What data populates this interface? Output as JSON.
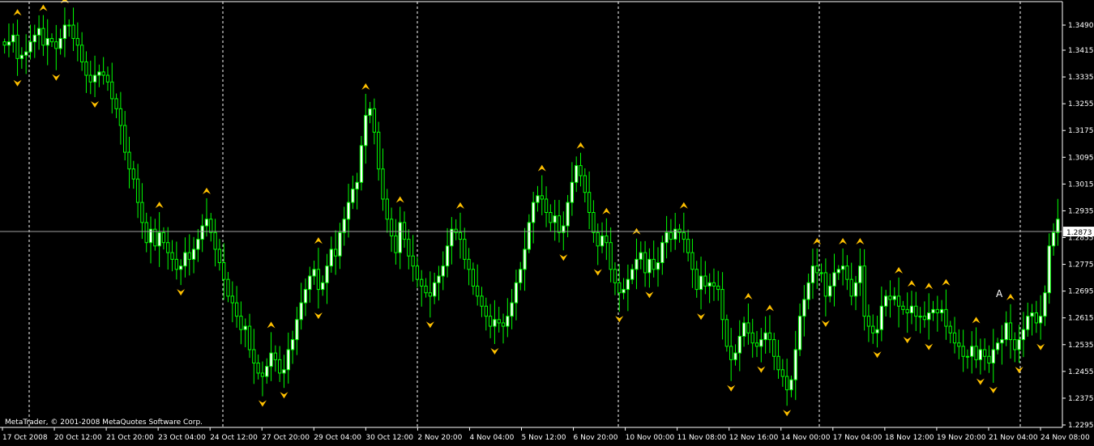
{
  "colors": {
    "background": "#000000",
    "axis": "#ffffff",
    "candle_up": "#ffffff",
    "candle_down": "#00ff00",
    "wick": "#00ff00",
    "fractal": "#ffc000",
    "bid_line": "#a0a0a0",
    "bid_label_bg": "#ffffff",
    "bid_label_text": "#000000"
  },
  "chart_data": {
    "type": "candlestick",
    "title": "",
    "watermark": "MetaTrader, © 2001-2008 MetaQuotes Software Corp.",
    "annotation": "A",
    "ylim": [
      1.2275,
      1.3535
    ],
    "y_ticks": [
      "1.3490",
      "1.3415",
      "1.3335",
      "1.3255",
      "1.3175",
      "1.3095",
      "1.3015",
      "1.2935",
      "1.2855",
      "1.2775",
      "1.2695",
      "1.2615",
      "1.2535",
      "1.2455",
      "1.2375",
      "1.2295"
    ],
    "current_price": "1.2873",
    "x_labels": [
      "17 Oct 2008",
      "20 Oct 12:00",
      "21 Oct 20:00",
      "23 Oct 04:00",
      "24 Oct 12:00",
      "27 Oct 20:00",
      "29 Oct 04:00",
      "30 Oct 12:00",
      "2 Nov 20:00",
      "4 Nov 04:00",
      "5 Nov 12:00",
      "6 Nov 20:00",
      "10 Nov 00:00",
      "11 Nov 08:00",
      "12 Nov 16:00",
      "14 Nov 00:00",
      "17 Nov 04:00",
      "18 Nov 12:00",
      "19 Nov 20:00",
      "21 Nov 04:00",
      "24 Nov 08:00"
    ],
    "grid": "vertical-dashed",
    "close_path": [
      1.343,
      1.344,
      1.346,
      1.339,
      1.34,
      1.341,
      1.344,
      1.346,
      1.348,
      1.343,
      1.345,
      1.344,
      1.342,
      1.345,
      1.349,
      1.349,
      1.345,
      1.343,
      1.338,
      1.334,
      1.332,
      1.334,
      1.335,
      1.334,
      1.332,
      1.327,
      1.324,
      1.319,
      1.311,
      1.306,
      1.303,
      1.296,
      1.29,
      1.284,
      1.288,
      1.283,
      1.287,
      1.284,
      1.281,
      1.279,
      1.276,
      1.277,
      1.281,
      1.279,
      1.282,
      1.285,
      1.289,
      1.291,
      1.287,
      1.282,
      1.278,
      1.273,
      1.268,
      1.266,
      1.262,
      1.258,
      1.259,
      1.252,
      1.248,
      1.245,
      1.244,
      1.247,
      1.251,
      1.249,
      1.245,
      1.246,
      1.252,
      1.255,
      1.261,
      1.266,
      1.27,
      1.274,
      1.276,
      1.27,
      1.272,
      1.277,
      1.282,
      1.28,
      1.287,
      1.291,
      1.296,
      1.3,
      1.302,
      1.313,
      1.322,
      1.324,
      1.317,
      1.306,
      1.297,
      1.291,
      1.286,
      1.281,
      1.29,
      1.285,
      1.28,
      1.277,
      1.273,
      1.271,
      1.269,
      1.268,
      1.272,
      1.274,
      1.277,
      1.283,
      1.288,
      1.287,
      1.285,
      1.279,
      1.276,
      1.271,
      1.268,
      1.265,
      1.262,
      1.259,
      1.261,
      1.26,
      1.259,
      1.262,
      1.266,
      1.272,
      1.276,
      1.282,
      1.29,
      1.296,
      1.298,
      1.297,
      1.293,
      1.29,
      1.292,
      1.287,
      1.289,
      1.296,
      1.302,
      1.307,
      1.304,
      1.299,
      1.293,
      1.287,
      1.283,
      1.286,
      1.284,
      1.276,
      1.272,
      1.269,
      1.27,
      1.273,
      1.276,
      1.279,
      1.281,
      1.275,
      1.279,
      1.276,
      1.278,
      1.284,
      1.287,
      1.285,
      1.288,
      1.287,
      1.285,
      1.281,
      1.276,
      1.27,
      1.274,
      1.271,
      1.272,
      1.271,
      1.27,
      1.261,
      1.253,
      1.249,
      1.251,
      1.256,
      1.26,
      1.257,
      1.254,
      1.253,
      1.255,
      1.257,
      1.255,
      1.25,
      1.246,
      1.244,
      1.24,
      1.243,
      1.252,
      1.262,
      1.267,
      1.272,
      1.277,
      1.275,
      1.275,
      1.268,
      1.271,
      1.275,
      1.276,
      1.277,
      1.273,
      1.268,
      1.272,
      1.277,
      1.262,
      1.259,
      1.257,
      1.258,
      1.265,
      1.268,
      1.267,
      1.268,
      1.265,
      1.264,
      1.263,
      1.265,
      1.262,
      1.262,
      1.261,
      1.263,
      1.264,
      1.263,
      1.264,
      1.259,
      1.257,
      1.254,
      1.253,
      1.25,
      1.25,
      1.253,
      1.249,
      1.252,
      1.25,
      1.248,
      1.252,
      1.254,
      1.255,
      1.26,
      1.255,
      1.252,
      1.255,
      1.258,
      1.262,
      1.263,
      1.26,
      1.262,
      1.269,
      1.283,
      1.287,
      1.291
    ]
  }
}
